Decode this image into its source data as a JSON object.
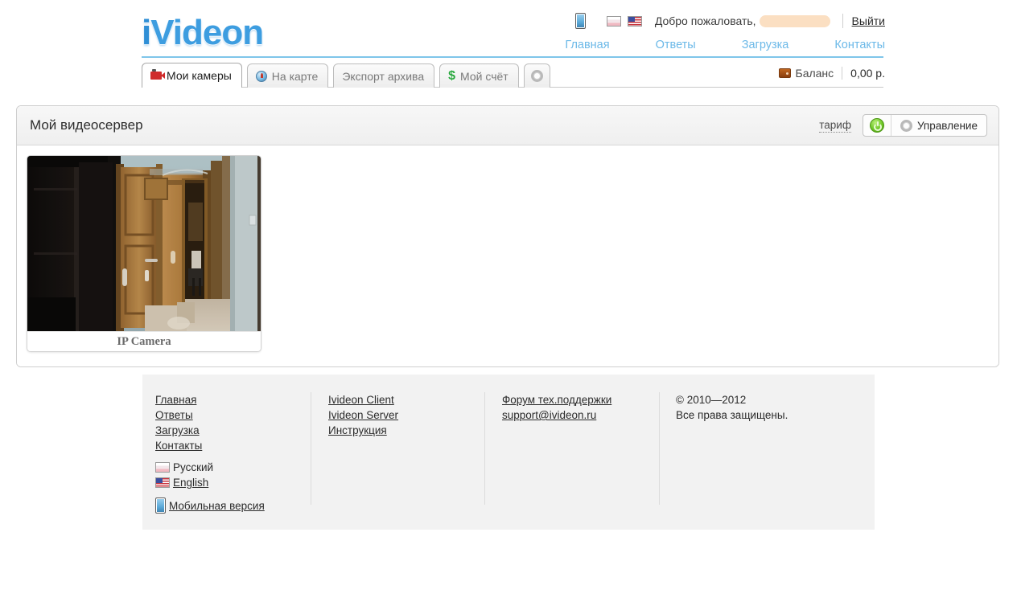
{
  "header": {
    "logo_i": "i",
    "logo_rest": "Videon",
    "mobile_icon": "mobile-phone-icon",
    "flag_ru": "russian-flag-icon",
    "flag_us": "usa-flag-icon",
    "welcome": "Добро пожаловать,",
    "username_redacted": "",
    "logout": "Выйти",
    "nav": [
      {
        "label": "Главная"
      },
      {
        "label": "Ответы"
      },
      {
        "label": "Загрузка"
      },
      {
        "label": "Контакты"
      }
    ]
  },
  "tabs": [
    {
      "label": "Мои камеры",
      "icon": "video-camera-icon",
      "active": true
    },
    {
      "label": "На карте",
      "icon": "globe-icon",
      "active": false
    },
    {
      "label": "Экспорт архива",
      "icon": "",
      "active": false
    },
    {
      "label": "Мой счёт",
      "icon": "dollar-icon",
      "active": false
    },
    {
      "label": "",
      "icon": "gear-icon",
      "active": false
    }
  ],
  "balance": {
    "icon": "wallet-icon",
    "label": "Баланс",
    "amount": "0,00 р."
  },
  "panel": {
    "title": "Мой видеосервер",
    "tarif_label": "тариф",
    "power_state": "on",
    "manage_label": "Управление",
    "manage_icon": "gear-icon"
  },
  "cameras": [
    {
      "name": "IP Camera",
      "status": "online"
    }
  ],
  "footer": {
    "col1": {
      "links": [
        "Главная",
        "Ответы",
        "Загрузка",
        "Контакты"
      ],
      "lang_ru": "Русский",
      "lang_en": "English",
      "mobile": "Мобильная версия"
    },
    "col2": {
      "links": [
        "Ivideon Client",
        "Ivideon Server",
        "Инструкция"
      ]
    },
    "col3": {
      "links": [
        "Форум тех.поддержки",
        "support@ivideon.ru"
      ]
    },
    "col4": {
      "copyright": "© 2010—2012",
      "rights": "Все права защищены."
    }
  },
  "colors": {
    "brand_blue": "#3d9de0",
    "nav_link": "#6cb9e8",
    "power_green": "#6ec726",
    "redaction": "#fbdfc2"
  }
}
